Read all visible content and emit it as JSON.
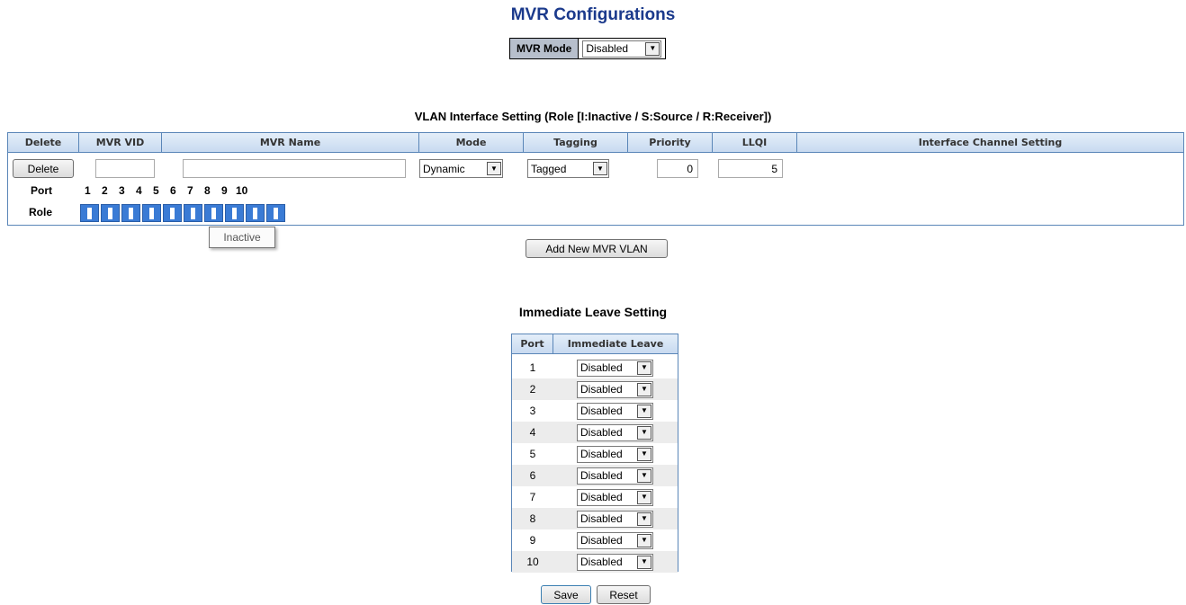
{
  "title": "MVR Configurations",
  "mvr_mode": {
    "label": "MVR Mode",
    "value": "Disabled"
  },
  "vlan_section": {
    "title": "VLAN Interface Setting (Role [I:Inactive / S:Source / R:Receiver])",
    "headers": [
      "Delete",
      "MVR VID",
      "MVR Name",
      "Mode",
      "Tagging",
      "Priority",
      "LLQI",
      "Interface Channel Setting"
    ],
    "row": {
      "delete_label": "Delete",
      "mvr_vid": "",
      "mvr_name": "",
      "mode": "Dynamic",
      "tagging": "Tagged",
      "priority": "0",
      "llqi": "5"
    },
    "port_label": "Port",
    "role_label": "Role",
    "ports": [
      "1",
      "2",
      "3",
      "4",
      "5",
      "6",
      "7",
      "8",
      "9",
      "10"
    ],
    "tooltip": "Inactive"
  },
  "add_button_label": "Add New MVR VLAN",
  "immediate_leave": {
    "title": "Immediate Leave Setting",
    "headers": [
      "Port",
      "Immediate Leave"
    ],
    "rows": [
      {
        "port": "1",
        "value": "Disabled"
      },
      {
        "port": "2",
        "value": "Disabled"
      },
      {
        "port": "3",
        "value": "Disabled"
      },
      {
        "port": "4",
        "value": "Disabled"
      },
      {
        "port": "5",
        "value": "Disabled"
      },
      {
        "port": "6",
        "value": "Disabled"
      },
      {
        "port": "7",
        "value": "Disabled"
      },
      {
        "port": "8",
        "value": "Disabled"
      },
      {
        "port": "9",
        "value": "Disabled"
      },
      {
        "port": "10",
        "value": "Disabled"
      }
    ]
  },
  "buttons": {
    "save": "Save",
    "reset": "Reset"
  },
  "colors": {
    "title": "#1b3a8c",
    "header_bg": "#c8daf0",
    "border": "#5a86b8",
    "role_box": "#3a7bd5"
  }
}
